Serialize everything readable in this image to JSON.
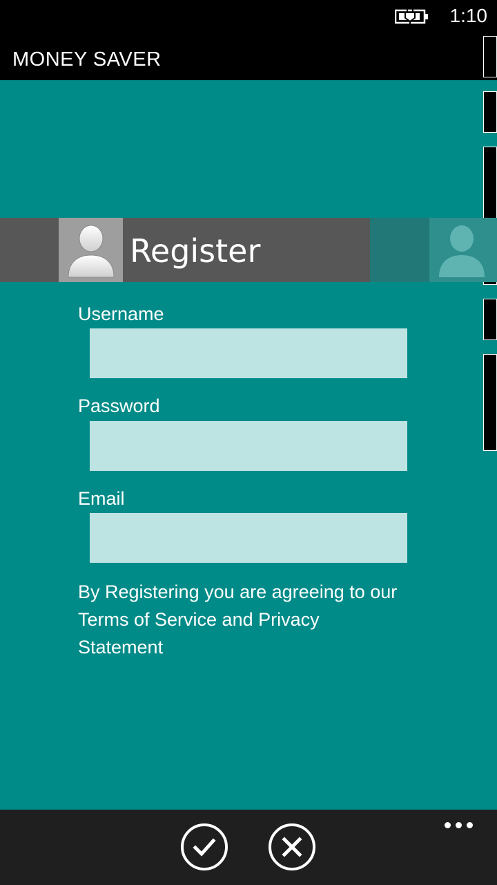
{
  "status_bar": {
    "time": "1:10",
    "battery_icon": "battery-charging-icon"
  },
  "app": {
    "title": "MONEY SAVER"
  },
  "pivot": {
    "title": "Register",
    "avatar_icon": "user-avatar-icon"
  },
  "form": {
    "username": {
      "label": "Username",
      "value": ""
    },
    "password": {
      "label": "Password",
      "value": ""
    },
    "email": {
      "label": "Email",
      "value": ""
    }
  },
  "terms": {
    "text": "By Registering you are agreeing to our Terms of Service and Privacy Statement"
  },
  "app_bar_actions": {
    "confirm_icon": "check-icon",
    "cancel_icon": "close-icon",
    "more_icon": "ellipsis-icon"
  },
  "colors": {
    "background": "#018b88",
    "header_band": "#575757",
    "input_fill": "#bee3e3",
    "app_bar": "#1f1f1f"
  }
}
